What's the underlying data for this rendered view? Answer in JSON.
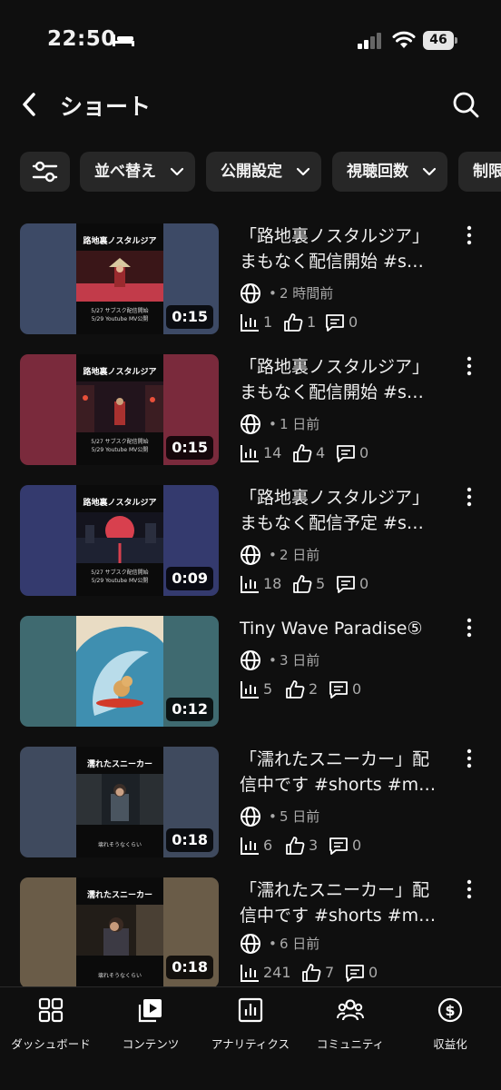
{
  "status_bar": {
    "time": "22:50",
    "battery": "46"
  },
  "header": {
    "title": "ショート"
  },
  "chips": [
    "並べ替え",
    "公開設定",
    "視聴回数",
    "制限"
  ],
  "videos": [
    {
      "title_line1": "「路地裏ノスタルジア」",
      "title_line2": "まもなく配信開始 #s…",
      "thumb_title": "路地裏ノスタルジア",
      "thumb_caption1": "5/27 サブスク配信開始",
      "thumb_caption2": "5/29 Youtube MV公開",
      "duration": "0:15",
      "age": "2 時間前",
      "views": "1",
      "likes": "1",
      "comments": "0",
      "bg": "#3d4a66"
    },
    {
      "title_line1": "「路地裏ノスタルジア」",
      "title_line2": "まもなく配信開始 #s…",
      "thumb_title": "路地裏ノスタルジア",
      "thumb_caption1": "5/27 サブスク配信開始",
      "thumb_caption2": "5/29 Youtube MV公開",
      "duration": "0:15",
      "age": "1 日前",
      "views": "14",
      "likes": "4",
      "comments": "0",
      "bg": "#7a2a3c"
    },
    {
      "title_line1": "「路地裏ノスタルジア」",
      "title_line2": "まもなく配信予定 #s…",
      "thumb_title": "路地裏ノスタルジア",
      "thumb_caption1": "5/27 サブスク配信開始",
      "thumb_caption2": "5/29 Youtube MV公開",
      "duration": "0:09",
      "age": "2 日前",
      "views": "18",
      "likes": "5",
      "comments": "0",
      "bg": "#343a6e"
    },
    {
      "title_line1": "Tiny Wave Paradise⑤",
      "title_line2": "",
      "thumb_title": "",
      "thumb_caption1": "",
      "thumb_caption2": "",
      "duration": "0:12",
      "age": "3 日前",
      "views": "5",
      "likes": "2",
      "comments": "0",
      "bg": "#3f6a70"
    },
    {
      "title_line1": "「濡れたスニーカー」配",
      "title_line2": "信中です #shorts #m…",
      "thumb_title": "濡れたスニーカー",
      "thumb_caption1": "壊れそうなくらい",
      "thumb_caption2": "",
      "duration": "0:18",
      "age": "5 日前",
      "views": "6",
      "likes": "3",
      "comments": "0",
      "bg": "#3f4a5e"
    },
    {
      "title_line1": "「濡れたスニーカー」配",
      "title_line2": "信中です #shorts #m…",
      "thumb_title": "濡れたスニーカー",
      "thumb_caption1": "壊れそうなくらい",
      "thumb_caption2": "",
      "duration": "0:18",
      "age": "6 日前",
      "views": "241",
      "likes": "7",
      "comments": "0",
      "bg": "#6a5c48"
    }
  ],
  "nav": [
    "ダッシュボード",
    "コンテンツ",
    "アナリティクス",
    "コミュニティ",
    "収益化"
  ],
  "colors": {
    "background": "#0f0f0f",
    "chip": "#272727",
    "text": "#f1f1f1",
    "secondary": "#aaaaaa"
  }
}
